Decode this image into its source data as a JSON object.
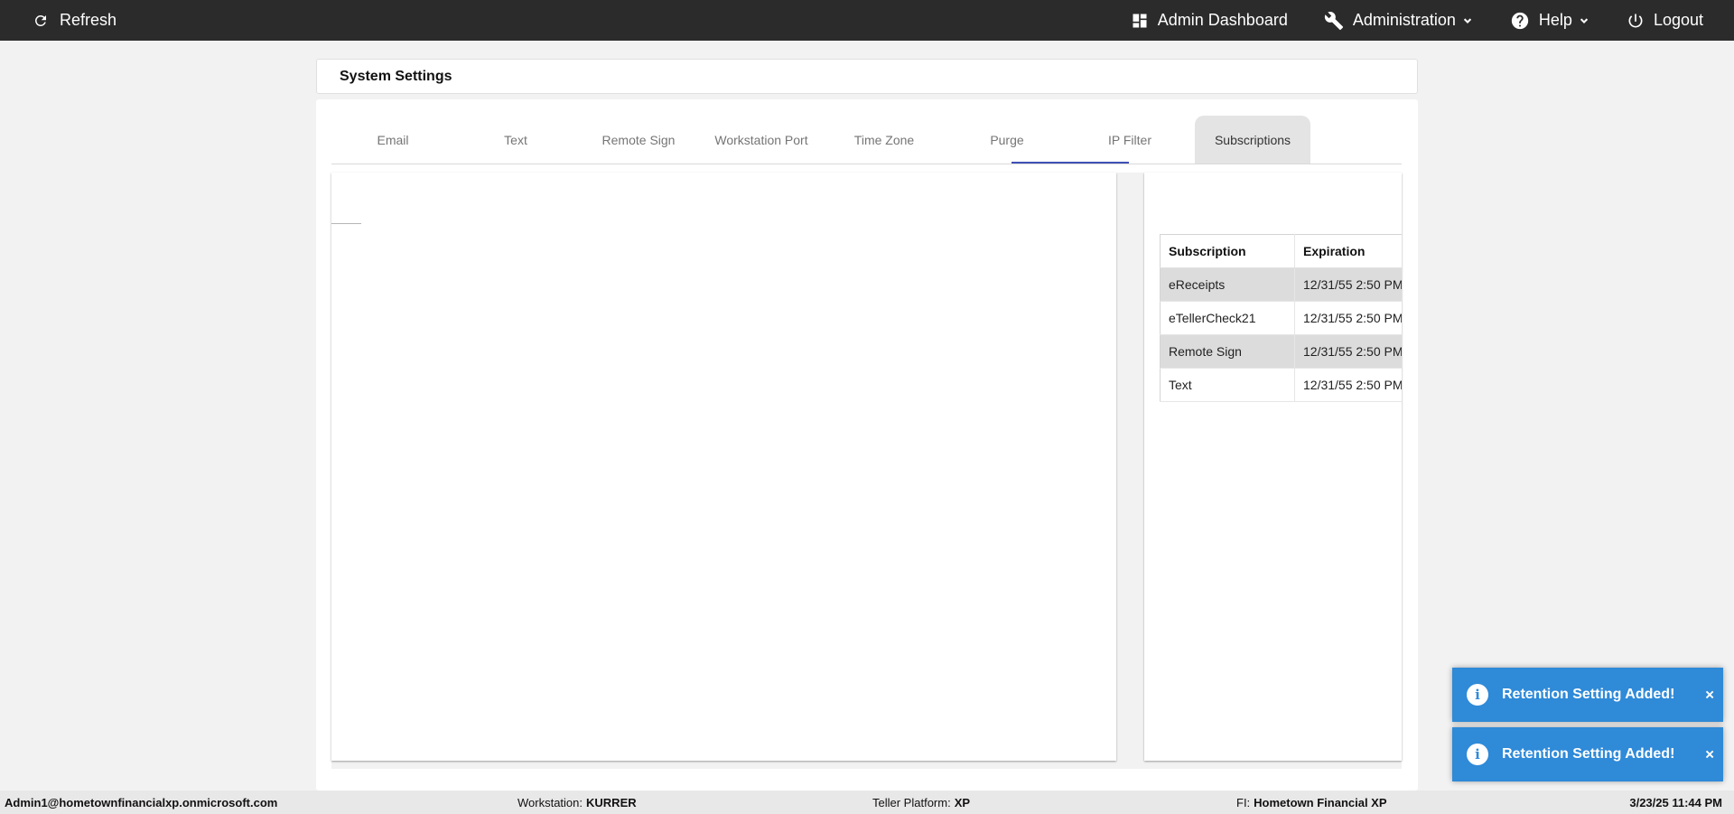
{
  "topbar": {
    "refresh_label": "Refresh",
    "admin_dashboard_label": "Admin Dashboard",
    "administration_label": "Administration",
    "help_label": "Help",
    "logout_label": "Logout"
  },
  "page": {
    "title": "System Settings"
  },
  "tabs": [
    "Email",
    "Text",
    "Remote Sign",
    "Workstation Port",
    "Time Zone",
    "Purge",
    "IP Filter",
    "Subscriptions"
  ],
  "subscriptions_table": {
    "headers": [
      "Subscription",
      "Expiration"
    ],
    "rows": [
      [
        "eReceipts",
        "12/31/55 2:50 PM"
      ],
      [
        "eTellerCheck21",
        "12/31/55 2:50 PM"
      ],
      [
        "Remote Sign",
        "12/31/55 2:50 PM"
      ],
      [
        "Text",
        "12/31/55 2:50 PM"
      ]
    ]
  },
  "statusbar": {
    "user": "Admin1@hometownfinancialxp.onmicrosoft.com",
    "workstation_label": "Workstation:",
    "workstation_value": "KURRER",
    "platform_label": "Teller Platform:",
    "platform_value": "XP",
    "fi_label": "FI:",
    "fi_value": "Hometown Financial XP",
    "datetime": "3/23/25 11:44 PM"
  },
  "toasts": [
    {
      "message": "Retention Setting Added!",
      "close": "×"
    },
    {
      "message": "Retention Setting Added!",
      "close": "×"
    }
  ],
  "colors": {
    "topbar_bg": "#2b2b2b",
    "tab_indicator": "#3f51b5",
    "toast_bg": "#2f8ad8"
  },
  "icons": {
    "refresh": "refresh-icon",
    "dashboard": "dashboard-icon",
    "administration": "wrench-icon",
    "help": "help-circle-icon",
    "logout": "power-icon",
    "toast": "info-icon"
  }
}
